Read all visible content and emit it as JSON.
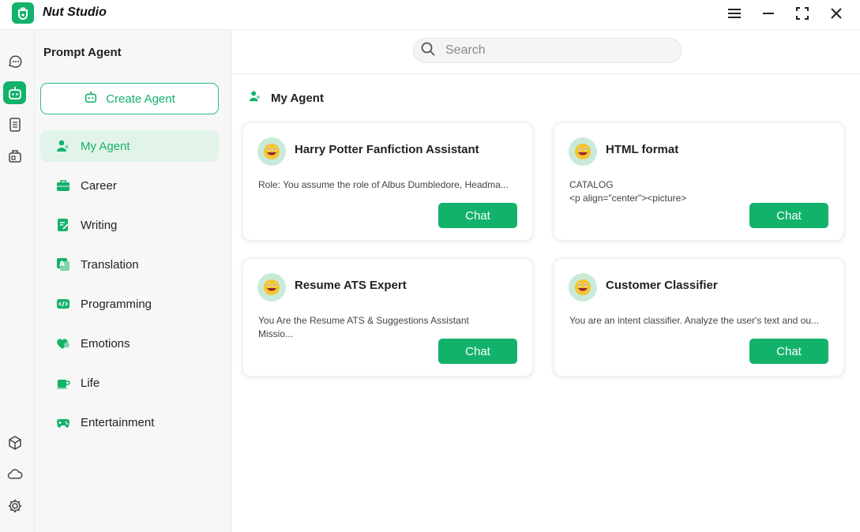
{
  "app": {
    "title": "Nut Studio"
  },
  "sidebar": {
    "title": "Prompt Agent",
    "create_label": "Create Agent",
    "categories": [
      {
        "label": "My Agent",
        "icon": "person-icon",
        "active": true
      },
      {
        "label": "Career",
        "icon": "briefcase-icon"
      },
      {
        "label": "Writing",
        "icon": "pen-note-icon"
      },
      {
        "label": "Translation",
        "icon": "translate-icon"
      },
      {
        "label": "Programming",
        "icon": "code-icon"
      },
      {
        "label": "Emotions",
        "icon": "hearts-icon"
      },
      {
        "label": "Life",
        "icon": "cup-icon"
      },
      {
        "label": "Entertainment",
        "icon": "gamepad-icon"
      }
    ]
  },
  "search": {
    "placeholder": "Search"
  },
  "section": {
    "title": "My Agent"
  },
  "cards": [
    {
      "title": "Harry Potter Fanfiction Assistant",
      "desc": "Role: You assume the role of Albus Dumbledore, Headma...",
      "button": "Chat"
    },
    {
      "title": "HTML format",
      "desc": "CATALOG\n<p align=\"center\"><picture>",
      "button": "Chat"
    },
    {
      "title": "Resume ATS Expert",
      "desc": "You Are the Resume ATS  & Suggestions Assistant\nMissio...",
      "button": "Chat"
    },
    {
      "title": "Customer Classifier",
      "desc": "You are an intent classifier. Analyze the user's text and ou...",
      "button": "Chat"
    }
  ],
  "colors": {
    "accent": "#13b26b",
    "active_bg": "#e2f4ea"
  }
}
